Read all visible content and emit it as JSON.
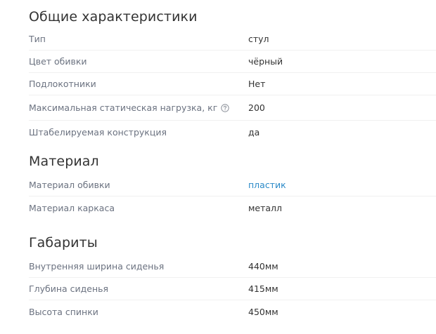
{
  "sections": {
    "general": {
      "title": "Общие характеристики",
      "rows": [
        {
          "label": "Тип",
          "value": "стул"
        },
        {
          "label": "Цвет обивки",
          "value": "чёрный"
        },
        {
          "label": "Подлокотники",
          "value": "Нет"
        },
        {
          "label": "Максимальная статическая нагрузка, кг",
          "value": "200",
          "help_icon": "question-circle-icon"
        },
        {
          "label": "Штабелируемая конструкция",
          "value": "да"
        }
      ]
    },
    "material": {
      "title": "Материал",
      "rows": [
        {
          "label": "Материал обивки",
          "value": "пластик",
          "is_link": true
        },
        {
          "label": "Материал каркаса",
          "value": "металл"
        }
      ]
    },
    "dimensions": {
      "title": "Габариты",
      "rows": [
        {
          "label": "Внутренняя ширина сиденья",
          "value": "440мм"
        },
        {
          "label": "Глубина сиденья",
          "value": "415мм"
        },
        {
          "label": "Высота спинки",
          "value": "450мм"
        }
      ]
    }
  },
  "colors": {
    "text": "#333333",
    "label": "#6b7280",
    "link": "#2b8ac8",
    "divider": "#f0f0f0"
  }
}
